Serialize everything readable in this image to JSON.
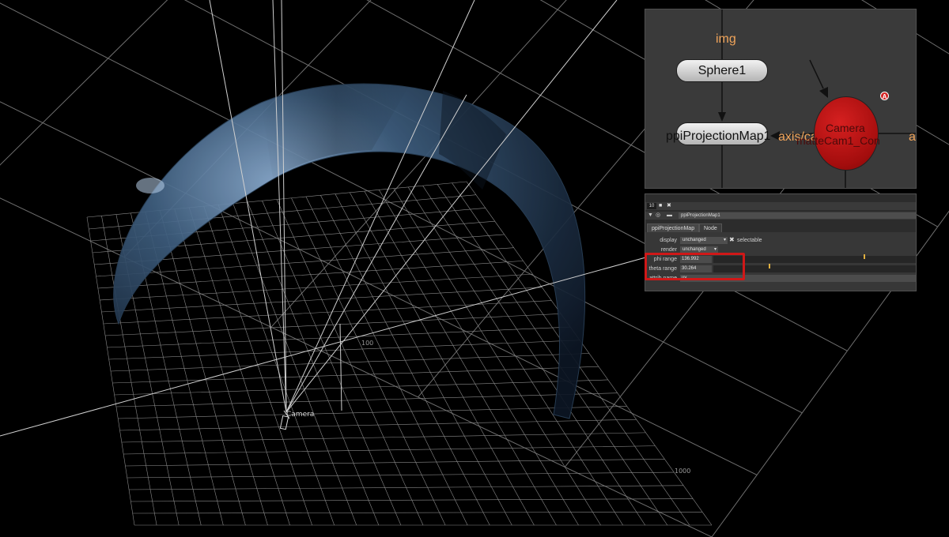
{
  "viewport": {
    "camera_label": "Camera",
    "axis_ticks": [
      "100",
      "1000"
    ]
  },
  "node_graph": {
    "sphere_node": "Sphere1",
    "projection_node": "ppiProjectionMap1",
    "camera_node": "Camera",
    "camera_node_sub": "matteCam1_Con",
    "input_img": "img",
    "input_axis_cam": "axis/cam",
    "input_a": "a",
    "camera_badge": "A",
    "colors": {
      "input_label": "#f0a45a",
      "camera_node": "#c01515",
      "node_fill": "#d8d8d8"
    }
  },
  "properties": {
    "toolbar_field": "10",
    "node_name": "ppiProjectionMap1",
    "tabs": [
      {
        "label": "ppiProjectionMap"
      },
      {
        "label": "Node"
      }
    ],
    "display_label": "display",
    "display_value": "unchanged",
    "selectable_label": "selectable",
    "render_label": "render",
    "render_value": "unchanged",
    "phi_label": "phi range",
    "phi_value": "136.992",
    "theta_label": "theta range",
    "theta_value": "30.264",
    "attrib_label": "attrib name",
    "attrib_value": "uv",
    "highlight_color": "#d01818"
  }
}
